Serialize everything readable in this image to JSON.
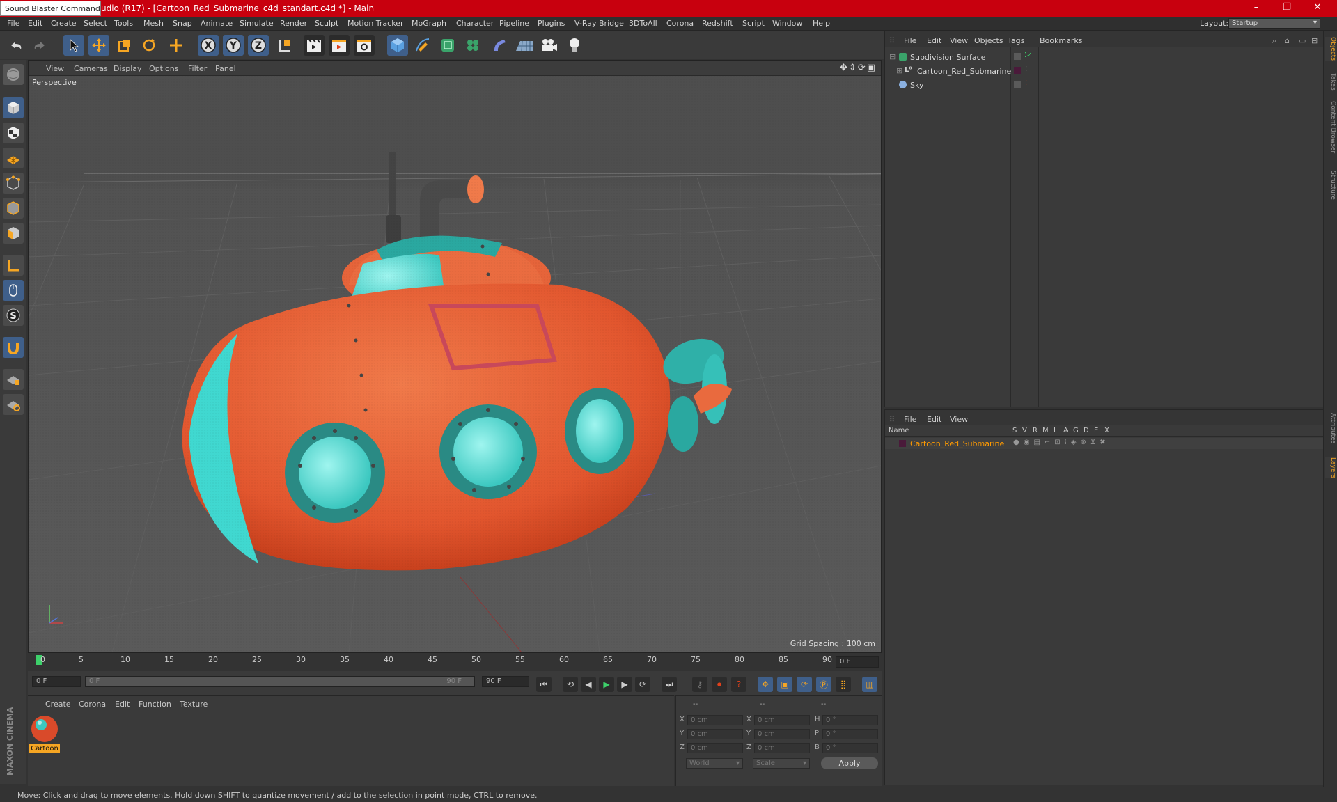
{
  "window": {
    "title": "udio (R17) - [Cartoon_Red_Submarine_c4d_standart.c4d *] - Main",
    "tooltip": "Sound Blaster Command",
    "controls": [
      "–",
      "❐",
      "✕"
    ]
  },
  "menubar": {
    "items": [
      "File",
      "Edit",
      "Create",
      "Select",
      "Tools",
      "Mesh",
      "Snap",
      "Animate",
      "Simulate",
      "Render",
      "Sculpt",
      "Motion Tracker",
      "MoGraph",
      "Character",
      "Pipeline",
      "Plugins",
      "V-Ray Bridge",
      "3DToAll",
      "Corona",
      "Redshift",
      "Script",
      "Window",
      "Help"
    ],
    "layout_label": "Layout:",
    "layout_value": "Startup"
  },
  "toolbar": {
    "axis_labels": [
      "X",
      "Y",
      "Z"
    ]
  },
  "viewport": {
    "menu": [
      "View",
      "Cameras",
      "Display",
      "Options",
      "Filter",
      "Panel"
    ],
    "label": "Perspective",
    "grid_spacing": "Grid Spacing : 100 cm"
  },
  "timeline": {
    "ticks": [
      "0",
      "5",
      "10",
      "15",
      "20",
      "25",
      "30",
      "35",
      "40",
      "45",
      "50",
      "55",
      "60",
      "65",
      "70",
      "75",
      "80",
      "85",
      "90"
    ],
    "current_frame": "0 F",
    "start_field": "0 F",
    "range_start": "0 F",
    "range_end": "90 F",
    "end_field": "90 F"
  },
  "material_panel": {
    "menu": [
      "Create",
      "Corona",
      "Edit",
      "Function",
      "Texture"
    ],
    "material_name": "Cartoon"
  },
  "coords": {
    "header": [
      "--",
      "--",
      "--"
    ],
    "rows": [
      {
        "a": "X",
        "av": "0 cm",
        "b": "X",
        "bv": "0 cm",
        "c": "H",
        "cv": "0 °"
      },
      {
        "a": "Y",
        "av": "0 cm",
        "b": "Y",
        "bv": "0 cm",
        "c": "P",
        "cv": "0 °"
      },
      {
        "a": "Z",
        "av": "0 cm",
        "b": "Z",
        "bv": "0 cm",
        "c": "B",
        "cv": "0 °"
      }
    ],
    "mode_world": "World",
    "mode_scale": "Scale",
    "apply": "Apply"
  },
  "object_manager": {
    "menu": [
      "File",
      "Edit",
      "View",
      "Objects",
      "Tags",
      "Bookmarks"
    ],
    "objects": [
      "Subdivision Surface",
      "Cartoon_Red_Submarine",
      "Sky"
    ]
  },
  "layer_manager": {
    "menu": [
      "File",
      "Edit",
      "View"
    ],
    "columns": [
      "Name",
      "S",
      "V",
      "R",
      "M",
      "L",
      "A",
      "G",
      "D",
      "E",
      "X"
    ],
    "layers": [
      "Cartoon_Red_Submarine"
    ],
    "layer_color": "#ff9a00"
  },
  "right_tabs": [
    "Objects",
    "Takes",
    "Content Browser",
    "Structure",
    "Attributes",
    "Layers"
  ],
  "branding": "MAXON CINEMA 4D",
  "status": "Move: Click and drag to move elements. Hold down SHIFT to quantize movement / add to the selection in point mode, CTRL to remove."
}
